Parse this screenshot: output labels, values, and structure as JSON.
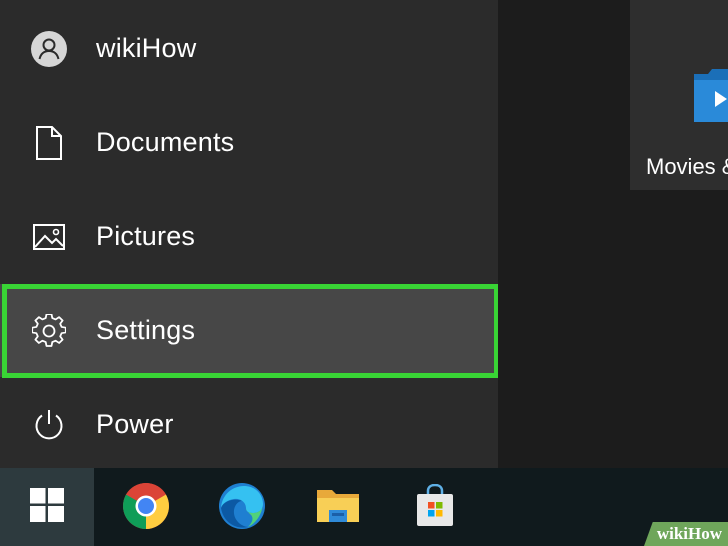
{
  "start_menu": {
    "items": [
      {
        "label": "wikiHow",
        "icon": "user-icon"
      },
      {
        "label": "Documents",
        "icon": "document-icon"
      },
      {
        "label": "Pictures",
        "icon": "pictures-icon"
      },
      {
        "label": "Settings",
        "icon": "gear-icon"
      },
      {
        "label": "Power",
        "icon": "power-icon"
      }
    ],
    "selected_item": "Settings"
  },
  "tiles": {
    "movies_label": "Movies &"
  },
  "taskbar": {
    "apps": [
      "windows-start-icon",
      "chrome-icon",
      "edge-icon",
      "file-explorer-icon",
      "store-icon"
    ]
  },
  "watermark": {
    "text": "wikiHow"
  },
  "colors": {
    "highlight": "#39d435",
    "panel": "#2b2b2b",
    "selected": "#474747",
    "taskbar": "#101a1d"
  }
}
